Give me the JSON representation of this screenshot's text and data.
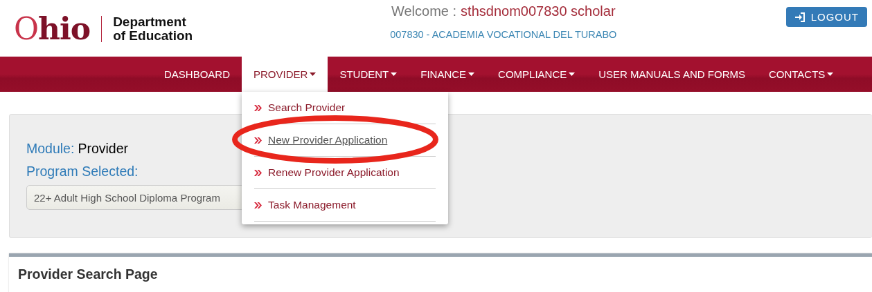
{
  "header": {
    "logo": {
      "wordmark": "Ohio",
      "line_1": "Department",
      "line_2": "of Education"
    },
    "welcome_label": "Welcome :",
    "user": "sthsdnom007830 scholar",
    "organization": "007830 - ACADEMIA VOCATIONAL DEL TURABO",
    "logout_button": "LOGOUT"
  },
  "nav": {
    "items": [
      {
        "label": "DASHBOARD",
        "dropdown": false,
        "selected": false
      },
      {
        "label": "PROVIDER",
        "dropdown": true,
        "selected": true
      },
      {
        "label": "STUDENT",
        "dropdown": true,
        "selected": false
      },
      {
        "label": "FINANCE",
        "dropdown": true,
        "selected": false
      },
      {
        "label": "COMPLIANCE",
        "dropdown": true,
        "selected": false
      },
      {
        "label": "USER MANUALS AND FORMS",
        "dropdown": false,
        "selected": false
      },
      {
        "label": "CONTACTS",
        "dropdown": true,
        "selected": false
      }
    ]
  },
  "dropdown_menu": {
    "items": [
      {
        "label": "Search Provider",
        "hovered": false,
        "circled": false
      },
      {
        "label": "New Provider Application",
        "hovered": true,
        "circled": true
      },
      {
        "label": "Renew Provider Application",
        "hovered": false,
        "circled": false
      },
      {
        "label": "Task Management",
        "hovered": false,
        "circled": false
      }
    ]
  },
  "module_panel": {
    "module_label": "Module:",
    "module_value": "Provider",
    "program_label": "Program Selected:",
    "program_value": "22+ Adult High School Diploma Program"
  },
  "search_card": {
    "title": "Provider Search Page"
  }
}
